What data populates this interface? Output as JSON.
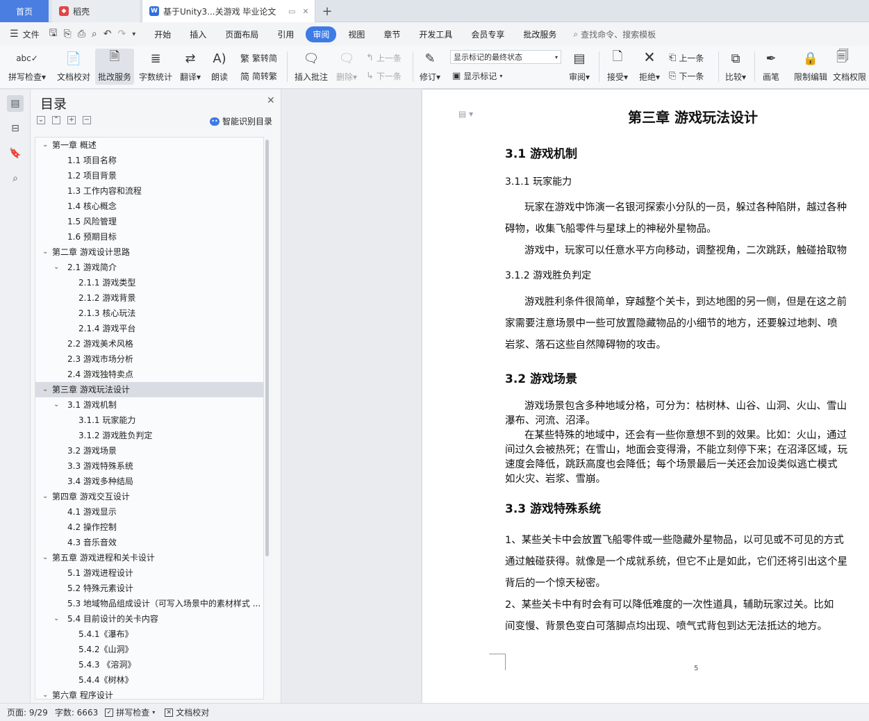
{
  "tabs": {
    "home": "首页",
    "daoke": "稻壳",
    "doc": "基于Unity3...关游戏 毕业论文"
  },
  "menu": {
    "file": "文件",
    "items": [
      "开始",
      "插入",
      "页面布局",
      "引用",
      "审阅",
      "视图",
      "章节",
      "开发工具",
      "会员专享",
      "批改服务"
    ],
    "active": "审阅",
    "search": "查找命令、搜索模板"
  },
  "ribbon": {
    "spell": "拼写检查",
    "doc_check": "文档校对",
    "review_service": "批改服务",
    "word_count": "字数统计",
    "translate": "翻译",
    "read_aloud": "朗读",
    "trad_simp": "繁转简",
    "simp_trad": "简转繁",
    "insert_comment": "插入批注",
    "delete": "删除",
    "prev_comment": "上一条",
    "next_comment": "下一条",
    "track": "修订",
    "markup_state": "显示标记的最终状态",
    "show_markup": "显示标记",
    "review": "审阅",
    "accept": "接受",
    "reject": "拒绝",
    "prev_change": "上一条",
    "next_change": "下一条",
    "compare": "比较",
    "pen": "画笔",
    "restrict": "限制编辑",
    "doc_perm": "文档权限"
  },
  "toc": {
    "title": "目录",
    "smart": "智能识别目录",
    "items": [
      {
        "level": 0,
        "text": "第一章  概述",
        "caret": true
      },
      {
        "level": 1,
        "text": "1.1 项目名称"
      },
      {
        "level": 1,
        "text": "1.2 项目背景"
      },
      {
        "level": 1,
        "text": "1.3 工作内容和流程"
      },
      {
        "level": 1,
        "text": "1.4 核心概念"
      },
      {
        "level": 1,
        "text": "1.5 风险管理"
      },
      {
        "level": 1,
        "text": "1.6 预期目标"
      },
      {
        "level": 0,
        "text": "第二章  游戏设计思路",
        "caret": true
      },
      {
        "level": 1,
        "text": "2.1 游戏简介",
        "caret": true
      },
      {
        "level": 2,
        "text": "2.1.1 游戏类型"
      },
      {
        "level": 2,
        "text": "2.1.2 游戏背景"
      },
      {
        "level": 2,
        "text": "2.1.3 核心玩法"
      },
      {
        "level": 2,
        "text": "2.1.4 游戏平台"
      },
      {
        "level": 1,
        "text": "2.2 游戏美术风格"
      },
      {
        "level": 1,
        "text": "2.3 游戏市场分析"
      },
      {
        "level": 1,
        "text": "2.4 游戏独特卖点"
      },
      {
        "level": 0,
        "text": "第三章  游戏玩法设计",
        "caret": true,
        "selected": true
      },
      {
        "level": 1,
        "text": "3.1 游戏机制",
        "caret": true
      },
      {
        "level": 2,
        "text": "3.1.1 玩家能力"
      },
      {
        "level": 2,
        "text": "3.1.2 游戏胜负判定"
      },
      {
        "level": 1,
        "text": "3.2 游戏场景"
      },
      {
        "level": 1,
        "text": "3.3 游戏特殊系统"
      },
      {
        "level": 1,
        "text": "3.4 游戏多种结局"
      },
      {
        "level": 0,
        "text": "第四章  游戏交互设计",
        "caret": true
      },
      {
        "level": 1,
        "text": "4.1 游戏显示"
      },
      {
        "level": 1,
        "text": "4.2 操作控制"
      },
      {
        "level": 1,
        "text": "4.3 音乐音效"
      },
      {
        "level": 0,
        "text": "第五章  游戏进程和关卡设计",
        "caret": true
      },
      {
        "level": 1,
        "text": "5.1 游戏进程设计"
      },
      {
        "level": 1,
        "text": "5.2  特殊元素设计"
      },
      {
        "level": 1,
        "text": "5.3 地域物品组成设计（可写入场景中的素材样式 ..."
      },
      {
        "level": 1,
        "text": "5.4 目前设计的关卡内容",
        "caret": true
      },
      {
        "level": 2,
        "text": "5.4.1《瀑布》"
      },
      {
        "level": 2,
        "text": "5.4.2《山洞》"
      },
      {
        "level": 2,
        "text": "5.4.3 《溶洞》"
      },
      {
        "level": 2,
        "text": "5.4.4《树林》"
      },
      {
        "level": 0,
        "text": "第六章  程序设计",
        "caret": true
      }
    ]
  },
  "document": {
    "chapter": "第三章  游戏玩法设计",
    "s31": "3.1 游戏机制",
    "s311": "3.1.1 玩家能力",
    "p1a": "玩家在游戏中饰演一名银河探索小分队的一员，躲过各种陷阱，越过各种",
    "p1b": "碍物，收集飞船零件与星球上的神秘外星物品。",
    "p2": "游戏中，玩家可以任意水平方向移动，调整视角，二次跳跃，触碰拾取物",
    "s312": "3.1.2 游戏胜负判定",
    "p3a": "游戏胜利条件很简单，穿越整个关卡，到达地图的另一侧，但是在这之前",
    "p3b": "家需要注意场景中一些可放置隐藏物品的小细节的地方，还要躲过地刺、喷",
    "p3c": "岩浆、落石这些自然障碍物的攻击。",
    "s32": "3.2 游戏场景",
    "p4a": "游戏场景包含多种地域分格，可分为：枯树林、山谷、山洞、火山、雪山",
    "p4b": "瀑布、河流、沼泽。",
    "p5a": "在某些特殊的地域中，还会有一些你意想不到的效果。比如：火山，通过",
    "p5b": "间过久会被热死；在雪山，地面会变得滑，不能立刻停下来；在沼泽区域，玩",
    "p5c": "速度会降低，跳跃高度也会降低；每个场景最后一关还会加设类似逃亡模式",
    "p5d": "如火灾、岩浆、雪崩。",
    "s33": "3.3 游戏特殊系统",
    "p6a": "1、某些关卡中会放置飞船零件或一些隐藏外星物品，以可见或不可见的方式",
    "p6b": "通过触碰获得。就像是一个成就系统，但它不止是如此，它们还将引出这个星",
    "p6c": "背后的一个惊天秘密。",
    "p7a": "2、某些关卡中有时会有可以降低难度的一次性道具，辅助玩家过关。比如",
    "p7b": "间变慢、背景色变白可落脚点均出现、喷气式背包到达无法抵达的地方。",
    "page_num": "5"
  },
  "status": {
    "page": "页面: 9/29",
    "words": "字数: 6663",
    "spell": "拼写检查",
    "check": "文档校对"
  }
}
